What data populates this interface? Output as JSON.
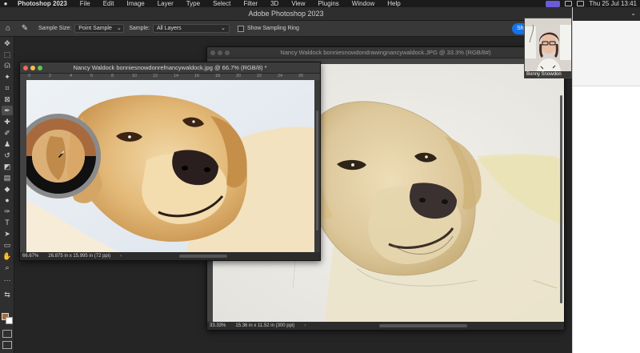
{
  "menubar": {
    "app": "Photoshop 2023",
    "items": [
      "File",
      "Edit",
      "Image",
      "Layer",
      "Type",
      "Select",
      "Filter",
      "3D",
      "View",
      "Plugins",
      "Window",
      "Help"
    ],
    "clock": "Thu 25 Jul  13:41"
  },
  "app_title": "Adobe Photoshop 2023",
  "options": {
    "sample_size_label": "Sample Size:",
    "sample_size_value": "Point Sample",
    "sample_label": "Sample:",
    "sample_value": "All Layers",
    "sampling_ring_label": "Show Sampling Ring",
    "share_label": "Sh"
  },
  "documents": [
    {
      "title": "Nancy Waldock bonniesnowdondrawingnancywaldock.JPG @ 33.3% (RGB/8#)",
      "zoom": "33.33%",
      "size": "15.36 in x 11.52 in (300 ppi)"
    },
    {
      "title": "Nancy Waldock bonniesnowdonrefnancywaldock.jpg @ 66.7% (RGB/8) *",
      "zoom": "66.67%",
      "size": "26.875 in x 15.995 in (72 ppi)",
      "ruler_ticks": [
        "0",
        "2",
        "4",
        "6",
        "8",
        "10",
        "12",
        "14",
        "16",
        "18",
        "20",
        "22",
        "24",
        "26"
      ]
    }
  ],
  "webcam": {
    "name": "Bonny Snowdon"
  },
  "colors": {
    "foreground": "#a86a3c",
    "background": "#ffffff",
    "accent": "#1473e6"
  },
  "tools": [
    "move-icon",
    "marquee-icon",
    "lasso-icon",
    "magic-wand-icon",
    "crop-icon",
    "frame-icon",
    "eyedropper-icon",
    "healing-icon",
    "brush-icon",
    "stamp-icon",
    "history-brush-icon",
    "eraser-icon",
    "gradient-icon",
    "blur-icon",
    "dodge-icon",
    "pen-icon",
    "type-icon",
    "path-select-icon",
    "rectangle-icon",
    "hand-icon",
    "zoom-icon",
    "more-icon"
  ]
}
